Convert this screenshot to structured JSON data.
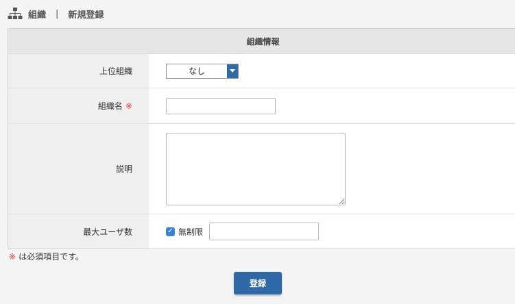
{
  "breadcrumb": {
    "icon": "org-chart-icon",
    "section": "組織",
    "separator": "|",
    "page": "新規登録"
  },
  "form": {
    "header": "組織情報",
    "parent_org": {
      "label": "上位組織",
      "value": "なし"
    },
    "org_name": {
      "label": "組織名",
      "required_mark": "※",
      "value": ""
    },
    "description": {
      "label": "説明",
      "value": ""
    },
    "max_users": {
      "label": "最大ユーザ数",
      "unlimited_label": "無制限",
      "unlimited_checked": true,
      "value": ""
    }
  },
  "note": {
    "mark": "※",
    "text": "は必須項目です。"
  },
  "submit_label": "登録",
  "colors": {
    "accent": "#2f6aa6",
    "required": "#ee3333",
    "checkbox": "#3b82d6"
  }
}
